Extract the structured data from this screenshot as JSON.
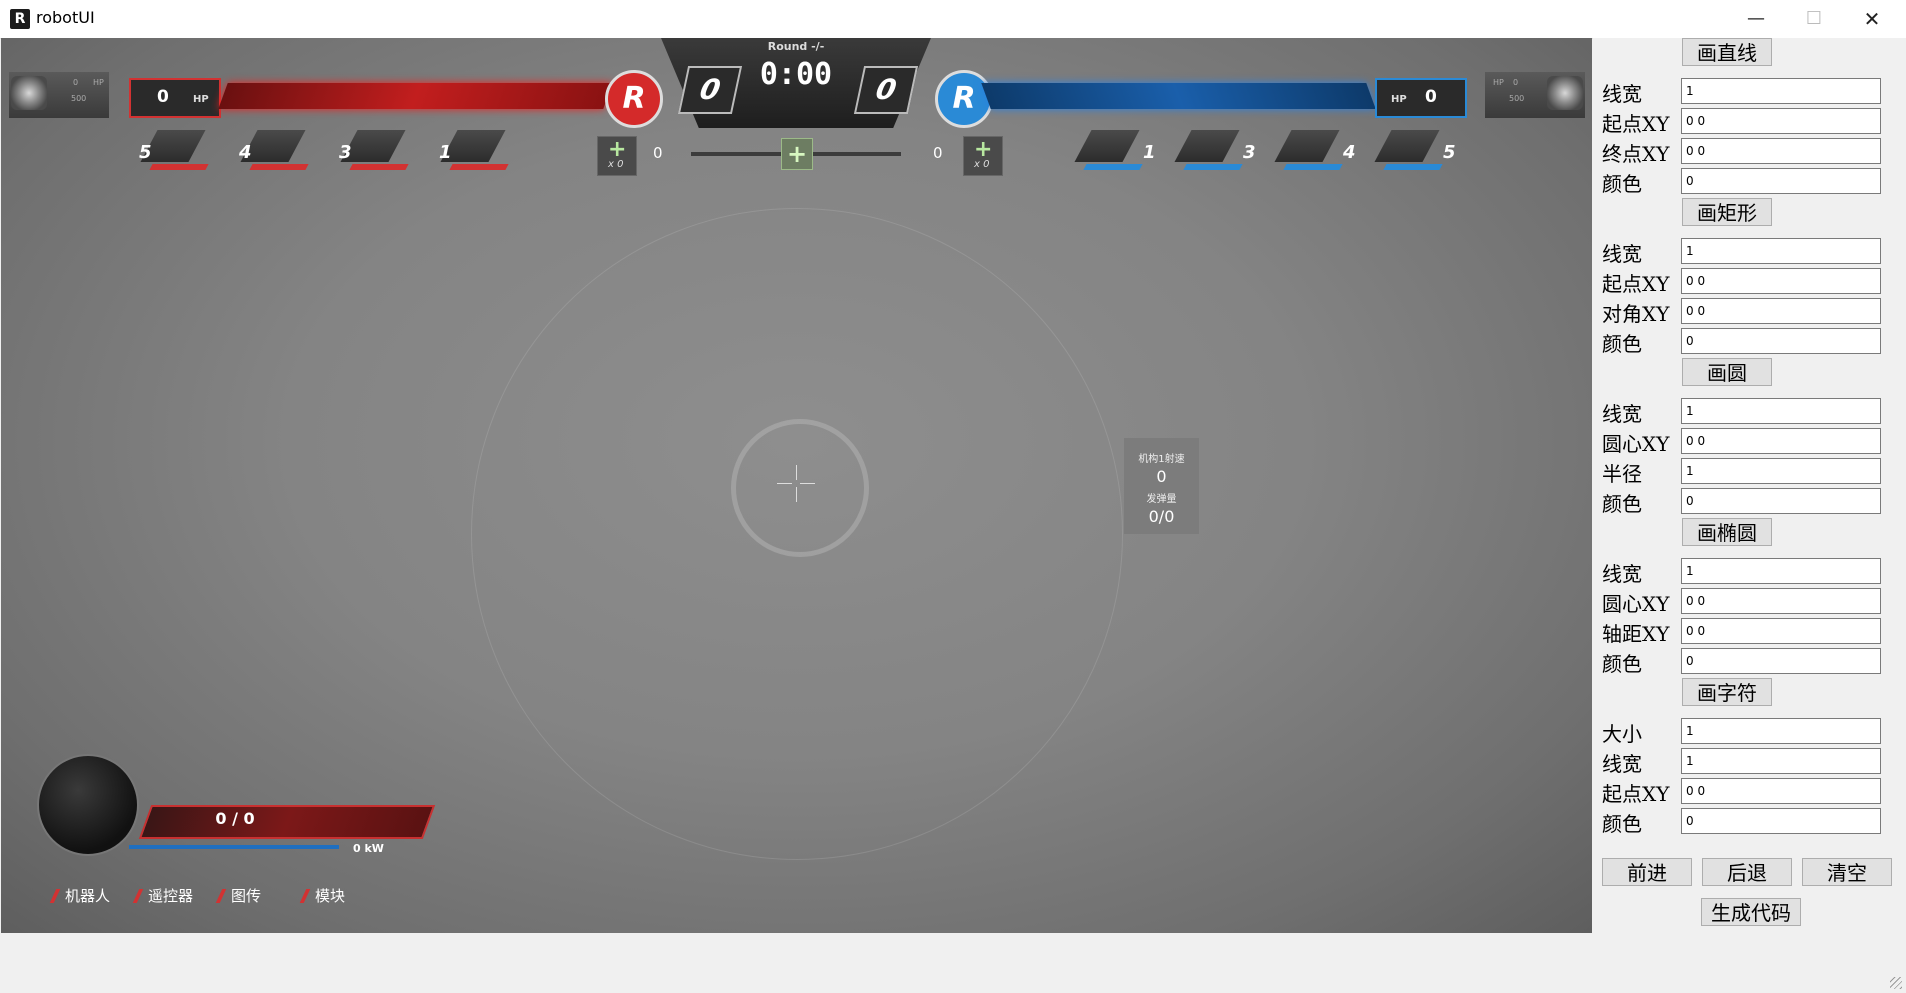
{
  "window": {
    "title": "robotUI"
  },
  "hud": {
    "round": "Round -/-",
    "timer": "0:00",
    "red": {
      "hp_value": "0",
      "hp_label": "HP",
      "score": "0",
      "logo": "R",
      "thumb_hp": "0",
      "thumb_hp_label": "HP",
      "thumb_max": "500",
      "slots": [
        "5",
        "4",
        "3",
        "1"
      ],
      "buff_count": "x 0",
      "buff_value": "0"
    },
    "blue": {
      "hp_value": "0",
      "hp_label": "HP",
      "score": "0",
      "logo": "R",
      "thumb_hp": "0",
      "thumb_hp_label": "HP",
      "thumb_max": "500",
      "slots": [
        "1",
        "3",
        "4",
        "5"
      ],
      "buff_count": "x 0",
      "buff_value": "0"
    },
    "shooter": {
      "speed_label": "机构1射速",
      "speed_value": "0",
      "ammo_label": "发弹量",
      "ammo_value": "0/0"
    },
    "bottom": {
      "ammo": "0 / 0",
      "power": "0 kW",
      "status_items": [
        "机器人",
        "遥控器",
        "图传",
        "模块"
      ]
    }
  },
  "panel": {
    "line": {
      "button": "画直线",
      "fields": [
        {
          "label": "线宽",
          "value": "1"
        },
        {
          "label": "起点XY",
          "value": "0 0"
        },
        {
          "label": "终点XY",
          "value": "0 0"
        },
        {
          "label": "颜色",
          "value": "0"
        }
      ]
    },
    "rect": {
      "button": "画矩形",
      "fields": [
        {
          "label": "线宽",
          "value": "1"
        },
        {
          "label": "起点XY",
          "value": "0 0"
        },
        {
          "label": "对角XY",
          "value": "0 0"
        },
        {
          "label": "颜色",
          "value": "0"
        }
      ]
    },
    "circle": {
      "button": "画圆",
      "fields": [
        {
          "label": "线宽",
          "value": "1"
        },
        {
          "label": "圆心XY",
          "value": "0 0"
        },
        {
          "label": "半径",
          "value": "1"
        },
        {
          "label": "颜色",
          "value": "0"
        }
      ]
    },
    "ellipse": {
      "button": "画椭圆",
      "fields": [
        {
          "label": "线宽",
          "value": "1"
        },
        {
          "label": "圆心XY",
          "value": "0 0"
        },
        {
          "label": "轴距XY",
          "value": "0 0"
        },
        {
          "label": "颜色",
          "value": "0"
        }
      ]
    },
    "text": {
      "button": "画字符",
      "fields": [
        {
          "label": "大小",
          "value": "1"
        },
        {
          "label": "线宽",
          "value": "1"
        },
        {
          "label": "起点XY",
          "value": "0 0"
        },
        {
          "label": "颜色",
          "value": "0"
        }
      ]
    },
    "actions": {
      "forward": "前进",
      "back": "后退",
      "clear": "清空",
      "generate": "生成代码"
    }
  }
}
